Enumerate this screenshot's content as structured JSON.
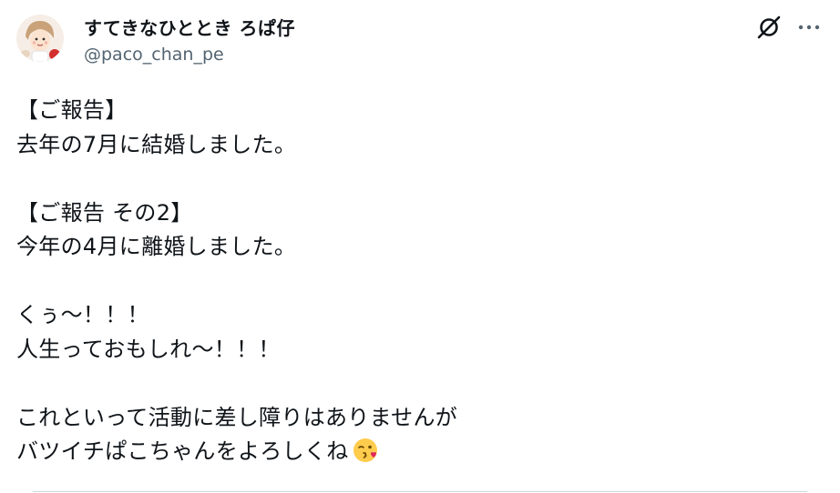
{
  "author": {
    "display_name": "すてきなひととき ろぱ仔",
    "handle": "@paco_chan_pe",
    "avatar_icon": "avatar-illustration"
  },
  "actions": {
    "grok_icon": "grok-icon",
    "more_icon": "more-horizontal-icon"
  },
  "post": {
    "lines": [
      "【ご報告】",
      "去年の7月に結婚しました。",
      "",
      "【ご報告 その2】",
      "今年の4月に離婚しました。",
      "",
      "くぅ～！！！",
      "人生っておもしれ～！！！",
      "",
      "これといって活動に差し障りはありませんが",
      "バツイチぱこちゃんをよろしくね"
    ],
    "trailing_emoji": "kissing-winking-face-emoji"
  },
  "colors": {
    "text": "#0f1419",
    "secondary": "#536471",
    "divider": "#cfd9de"
  }
}
